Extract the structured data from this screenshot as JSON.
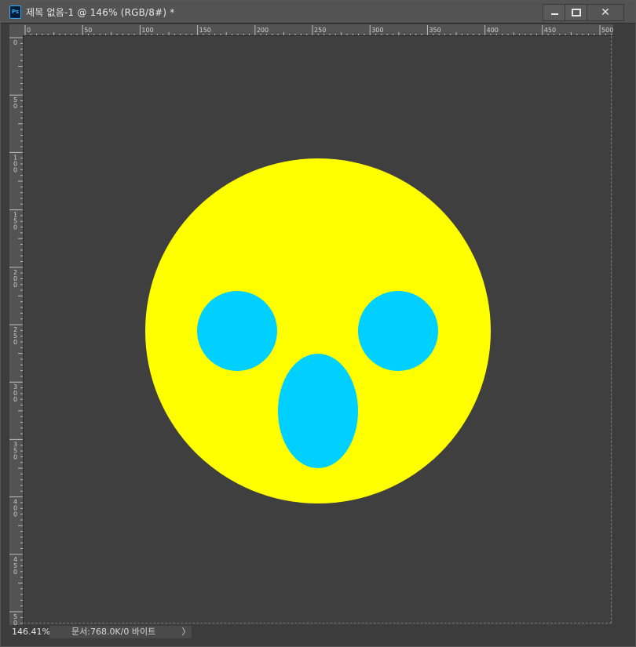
{
  "window": {
    "app_icon": "Ps",
    "title": "제목 없음-1 @ 146% (RGB/8#) *",
    "buttons": {
      "minimize": "minimize-icon",
      "maximize": "maximize-icon",
      "close": "close-icon"
    }
  },
  "rulers": {
    "top_labels": [
      "0",
      "50",
      "100",
      "150",
      "200",
      "250",
      "300",
      "350",
      "400",
      "450",
      "500"
    ],
    "left_labels": [
      "0",
      "50",
      "100",
      "150",
      "200",
      "250",
      "300",
      "350",
      "400",
      "450",
      "50"
    ]
  },
  "artwork": {
    "background": "#3f3f3f",
    "face_color": "#ffff00",
    "feature_color": "#00d0ff"
  },
  "status": {
    "zoom": "146.41%",
    "doc_info": "문서:768.0K/0 바이트",
    "arrow": "〉"
  }
}
